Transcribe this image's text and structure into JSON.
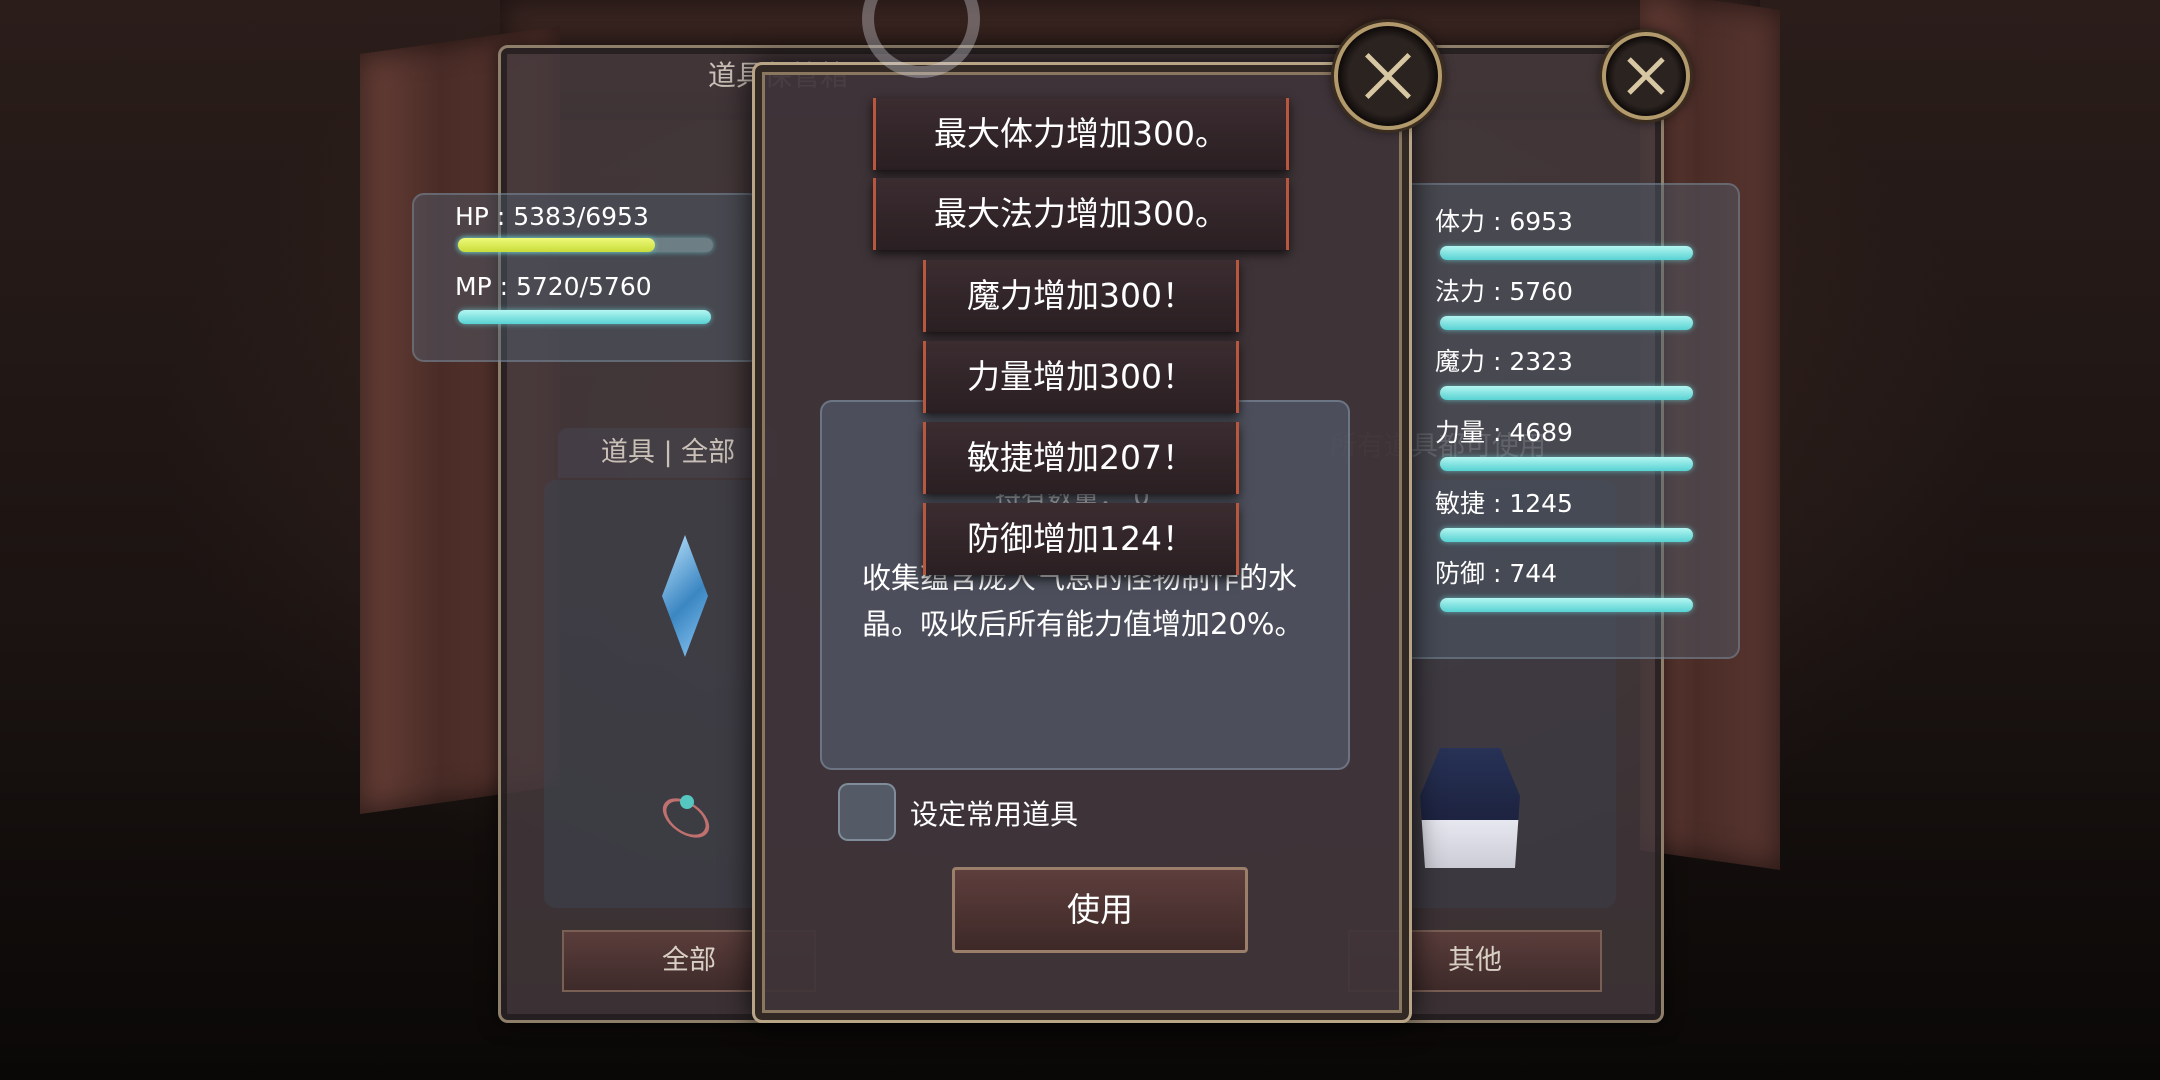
{
  "background_window": {
    "title": "道具保管箱",
    "item_tab_label": "道具 | 全部",
    "right_hint": "所有道具都可使用",
    "bottom_tabs": [
      "全部",
      "其他"
    ]
  },
  "hp_mp": {
    "hp_text": "HP : 5383/6953",
    "hp_fraction": 0.774,
    "mp_text": "MP : 5720/5760",
    "mp_fraction": 0.993
  },
  "attributes": [
    {
      "text": "体力 : 6953"
    },
    {
      "text": "法力 : 5760"
    },
    {
      "text": "魔力 : 2323"
    },
    {
      "text": "力量 : 4689"
    },
    {
      "text": "敏捷 : 1245"
    },
    {
      "text": "防御 : 744"
    }
  ],
  "dialog": {
    "count_label": "持有数量： 0",
    "description": "收集蕴含庞大气息的怪物制作的水晶。吸收后所有能力值增加20%。",
    "checkbox_label": "设定常用道具",
    "use_button": "使用"
  },
  "popups": [
    "最大体力增加300。",
    "最大法力增加300。",
    "魔力增加300！",
    "力量增加300！",
    "敏捷增加207！",
    "防御增加124！"
  ],
  "icons": {
    "close": "close-icon",
    "crystal": "crystal-item-icon",
    "ring": "ring-item-icon",
    "armor": "armor-item-icon",
    "spinner": "loading-spinner-icon"
  }
}
